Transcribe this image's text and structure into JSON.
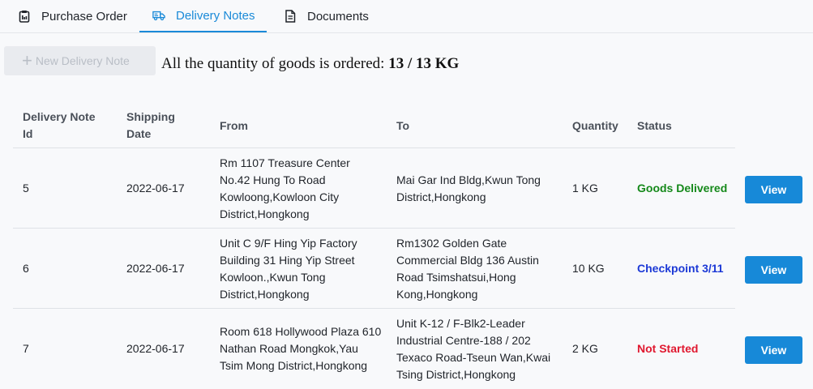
{
  "tabs": [
    {
      "label": "Purchase Order",
      "icon": "clipboard-icon",
      "active": false
    },
    {
      "label": "Delivery Notes",
      "icon": "truck-icon",
      "active": true
    },
    {
      "label": "Documents",
      "icon": "document-icon",
      "active": false
    }
  ],
  "toolbar": {
    "new_button_label": "New Delivery Note",
    "summary_text": "All the quantity of goods is ordered:",
    "summary_value": "13 / 13 KG"
  },
  "table": {
    "headers": {
      "id": "Delivery Note Id",
      "date": "Shipping Date",
      "from": "From",
      "to": "To",
      "quantity": "Quantity",
      "status": "Status"
    },
    "rows": [
      {
        "id": "5",
        "date": "2022-06-17",
        "from": "Rm 1107 Treasure Center No.42 Hung To Road Kowloong,Kowloon City District,Hongkong",
        "to": "Mai Gar Ind Bldg,Kwun Tong District,Hongkong",
        "quantity": "1 KG",
        "status": "Goods Delivered",
        "action": "View"
      },
      {
        "id": "6",
        "date": "2022-06-17",
        "from": "Unit C 9/F Hing Yip Factory Building 31 Hing Yip Street Kowloon.,Kwun Tong District,Hongkong",
        "to": "Rm1302 Golden Gate Commercial Bldg 136 Austin Road Tsimshatsui,Hong Kong,Hongkong",
        "quantity": "10 KG",
        "status": "Checkpoint 3/11",
        "action": "View"
      },
      {
        "id": "7",
        "date": "2022-06-17",
        "from": "Room 618 Hollywood Plaza 610 Nathan Road Mongkok,Yau Tsim Mong District,Hongkong",
        "to": "Unit K-12 / F-Blk2-Leader Industrial Centre-188 / 202 Texaco Road-Tseun Wan,Kwai Tsing District,Hongkong",
        "quantity": "2 KG",
        "status": "Not Started",
        "action": "View"
      }
    ]
  },
  "colors": {
    "accent": "#1a8ad8",
    "delivered": "#15891a",
    "checkpoint": "#1c39d6",
    "not_started": "#e0182f"
  }
}
